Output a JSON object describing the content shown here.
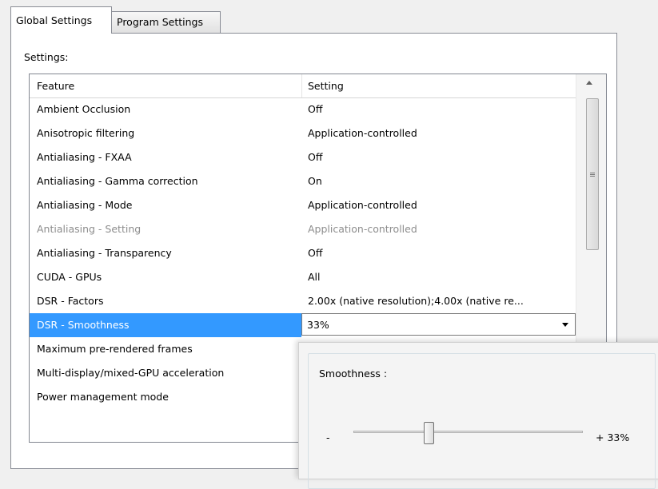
{
  "tabs": [
    {
      "label": "Global Settings"
    },
    {
      "label": "Program Settings"
    }
  ],
  "settings_label": "Settings:",
  "table": {
    "headers": {
      "feature": "Feature",
      "setting": "Setting"
    },
    "rows": [
      {
        "feature": "Ambient Occlusion",
        "setting": "Off"
      },
      {
        "feature": "Anisotropic filtering",
        "setting": "Application-controlled"
      },
      {
        "feature": "Antialiasing - FXAA",
        "setting": "Off"
      },
      {
        "feature": "Antialiasing - Gamma correction",
        "setting": "On"
      },
      {
        "feature": "Antialiasing - Mode",
        "setting": "Application-controlled"
      },
      {
        "feature": "Antialiasing - Setting",
        "setting": "Application-controlled"
      },
      {
        "feature": "Antialiasing - Transparency",
        "setting": "Off"
      },
      {
        "feature": "CUDA - GPUs",
        "setting": "All"
      },
      {
        "feature": "DSR - Factors",
        "setting": "2.00x (native resolution);4.00x (native re..."
      },
      {
        "feature": "DSR - Smoothness",
        "setting": "33%"
      },
      {
        "feature": "Maximum pre-rendered frames",
        "setting": ""
      },
      {
        "feature": "Multi-display/mixed-GPU acceleration",
        "setting": ""
      },
      {
        "feature": "Power management mode",
        "setting": ""
      }
    ]
  },
  "popup": {
    "title": "Smoothness :",
    "minus": "-",
    "plus_value": "+ 33%",
    "slider_fraction": 0.33
  }
}
